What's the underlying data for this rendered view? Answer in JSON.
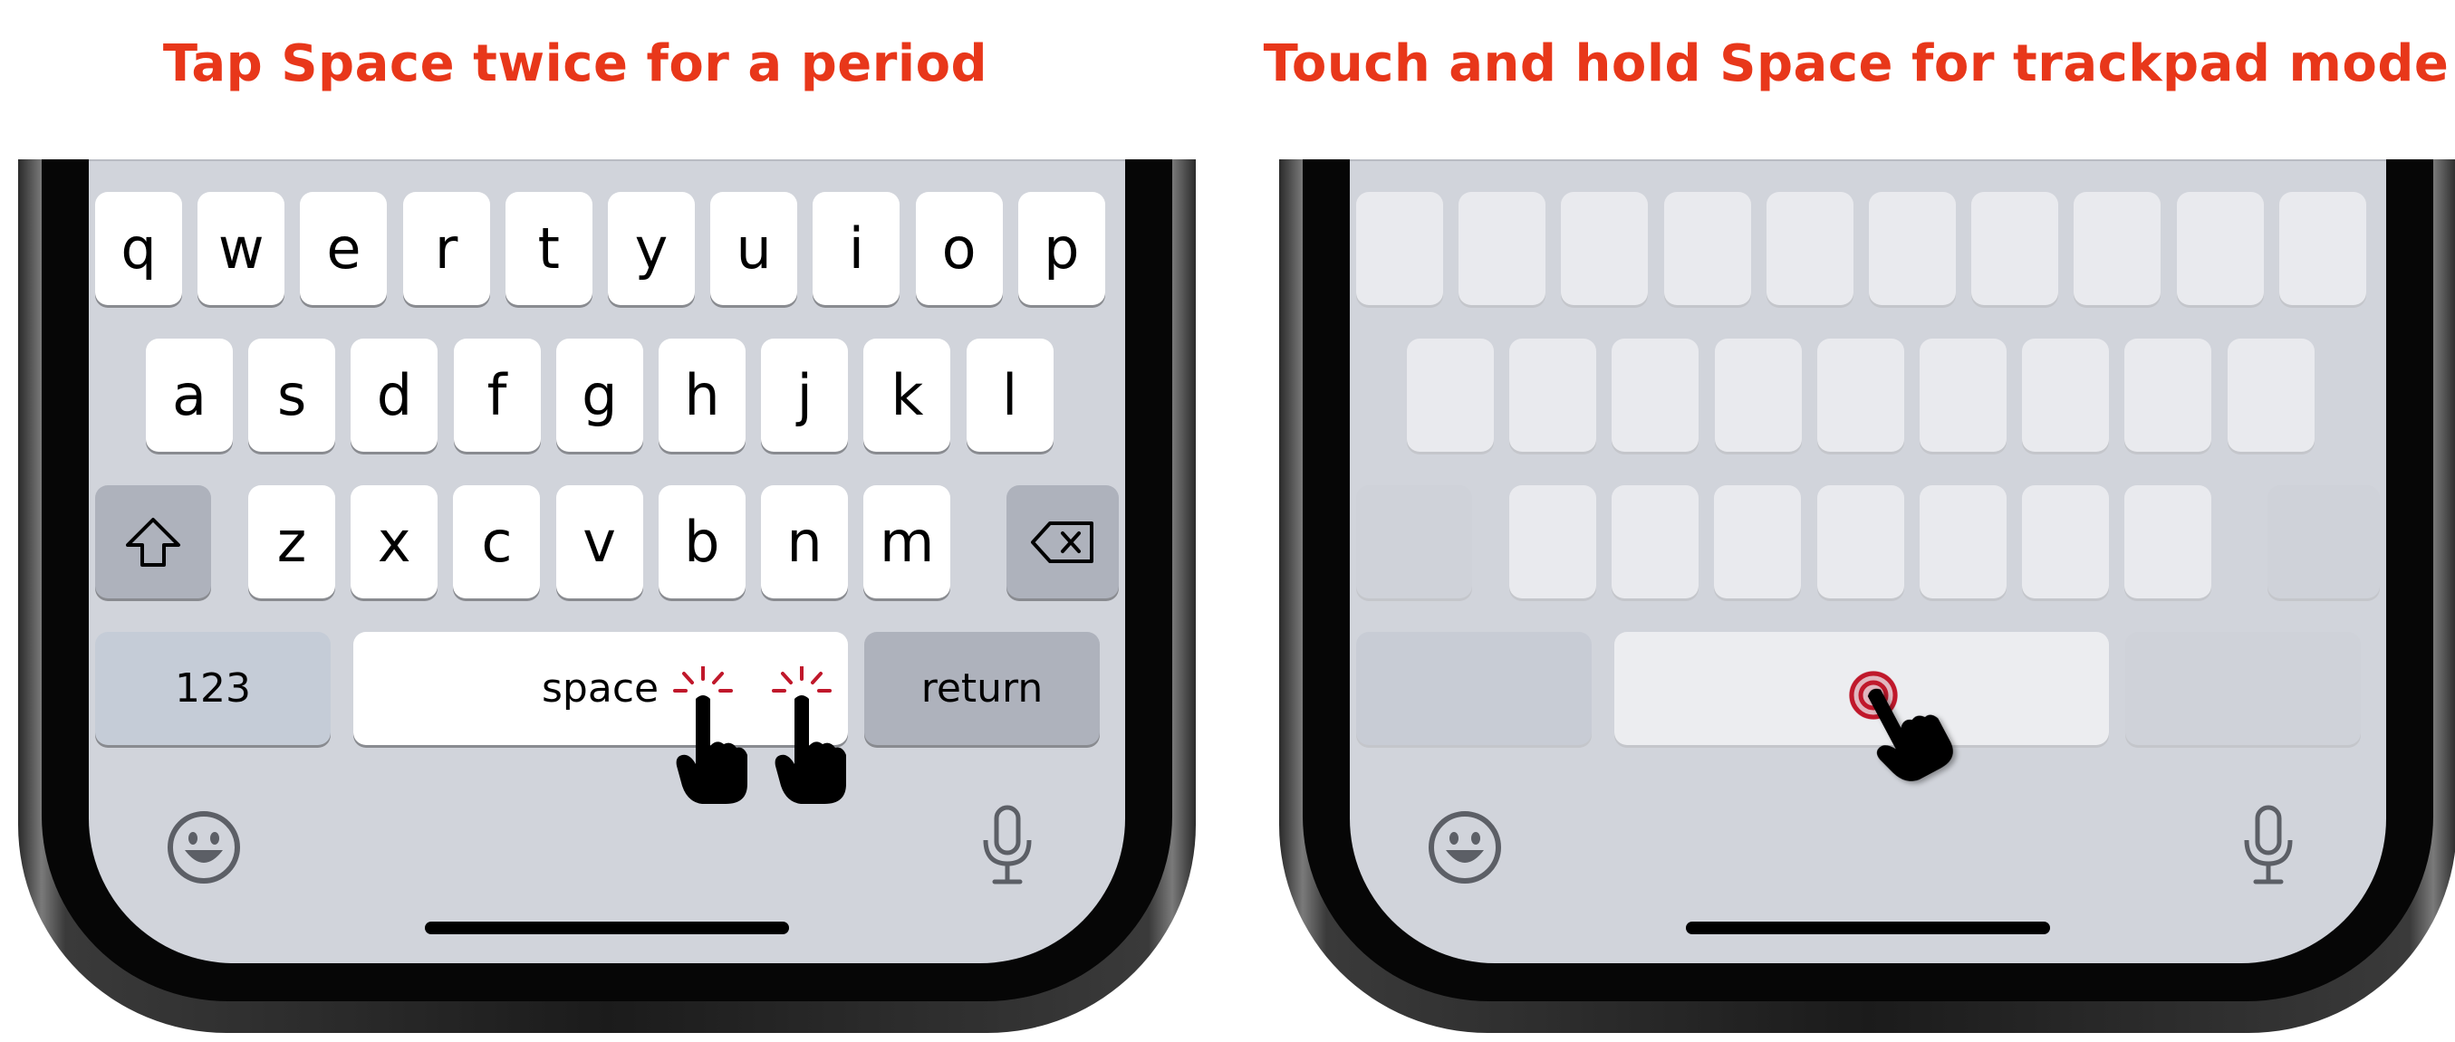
{
  "left": {
    "heading": "Tap Space twice for a period",
    "keyboard": {
      "row1": [
        "q",
        "w",
        "e",
        "r",
        "t",
        "y",
        "u",
        "i",
        "o",
        "p"
      ],
      "row2": [
        "a",
        "s",
        "d",
        "f",
        "g",
        "h",
        "j",
        "k",
        "l"
      ],
      "row3": [
        "z",
        "x",
        "c",
        "v",
        "b",
        "n",
        "m"
      ],
      "numbers_key": "123",
      "space_key": "space",
      "return_key": "return"
    }
  },
  "right": {
    "heading": "Touch and hold Space for trackpad mode"
  },
  "icons": {
    "shift": "shift-icon",
    "delete": "delete-icon",
    "emoji": "emoji-icon",
    "mic": "microphone-icon",
    "tap": "tap-hand-icon",
    "hold": "touch-hold-hand-icon"
  },
  "colors": {
    "heading": "#e8371a",
    "keyboard_bg": "#d1d4db",
    "tap_accent": "#c0182b"
  }
}
